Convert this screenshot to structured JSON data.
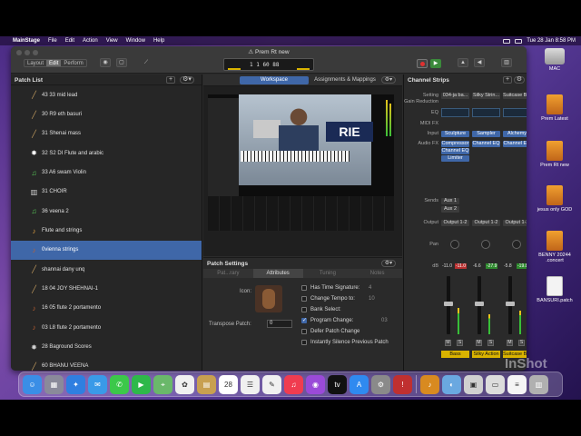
{
  "menubar": {
    "apple": "",
    "app_name": "MainStage",
    "items": [
      "File",
      "Edit",
      "Action",
      "View",
      "Window",
      "Help"
    ],
    "datetime": "Tue 28 Jan  8:58 PM"
  },
  "desktop_icons": [
    {
      "label": "MAC",
      "kind": "drive"
    },
    {
      "label": "Prem Latest",
      "kind": "doc"
    },
    {
      "label": "Prem Rt new",
      "kind": "doc"
    },
    {
      "label": "jesus only GOD",
      "kind": "doc"
    },
    {
      "label": "BENNY 20244 .concert",
      "kind": "doc"
    },
    {
      "label": "BANSURI.patch",
      "kind": "doc2"
    }
  ],
  "window": {
    "title": "⚠ Prem Rt new",
    "mode_tabs": [
      "Layout",
      "Edit",
      "Perform"
    ],
    "active_mode": "Edit",
    "lcd_counter": "1 1  60  88"
  },
  "patch_list": {
    "title": "Patch List",
    "add": "+",
    "gear": "⚙▾",
    "patches": [
      {
        "label": "43 33 mid lead",
        "icon": "flute-icon",
        "glyph": "╱",
        "color": "#c8a060"
      },
      {
        "label": "30 R9 eth basuri",
        "icon": "flute-icon",
        "glyph": "╱",
        "color": "#c8a060"
      },
      {
        "label": "31 Shenai mass",
        "icon": "flute-icon",
        "glyph": "╱",
        "color": "#c8a060"
      },
      {
        "label": "32 S2 DI Flute and arabic",
        "icon": "starburst-icon",
        "glyph": "✸",
        "color": "#ffffff"
      },
      {
        "label": "33 A6 swam Violin",
        "icon": "music-note-icon",
        "glyph": "♫",
        "color": "#5ad05a"
      },
      {
        "label": "31 CHOIR",
        "icon": "organ-icon",
        "glyph": "▥",
        "color": "#cfcfcf"
      },
      {
        "label": "36 veena 2",
        "icon": "music-note-icon",
        "glyph": "♫",
        "color": "#5ad05a"
      },
      {
        "label": "Flute and strings",
        "icon": "guitar-icon",
        "glyph": "♪",
        "color": "#e0a040"
      },
      {
        "label": "0vienna strings",
        "icon": "violin-icon",
        "glyph": "♪",
        "color": "#c06030"
      },
      {
        "label": "shannai dany unq",
        "icon": "flute-icon",
        "glyph": "╱",
        "color": "#c8a060"
      },
      {
        "label": "18 04 JOY SHEHNAI-1",
        "icon": "flute-icon",
        "glyph": "╱",
        "color": "#c8a060"
      },
      {
        "label": "16 05 flute 2 portamento",
        "icon": "violin-icon",
        "glyph": "♪",
        "color": "#c06030"
      },
      {
        "label": "03 L8 flute 2 portamento",
        "icon": "violin-icon",
        "glyph": "♪",
        "color": "#c06030"
      },
      {
        "label": "28 Baground Scores",
        "icon": "starburst-icon",
        "glyph": "✸",
        "color": "#cfcfcf"
      },
      {
        "label": "60 BHANU VEENA",
        "icon": "flute-icon",
        "glyph": "╱",
        "color": "#c8a060"
      }
    ],
    "selected_index": 8
  },
  "workspace": {
    "tabs": [
      "Workspace",
      "Assignments & Mappings"
    ],
    "active_tab": "Workspace",
    "banner_text": "RIE"
  },
  "patch_settings": {
    "title": "Patch Settings",
    "tabs": [
      "Pat...rary",
      "Attributes",
      "Tuning",
      "Notes"
    ],
    "active_tab": "Attributes",
    "icon_label": "Icon:",
    "transpose_label": "Transpose Patch:",
    "transpose_value": "0",
    "options": [
      {
        "label": "Has Time Signature:",
        "checked": false,
        "value": "4"
      },
      {
        "label": "Change Tempo to:",
        "checked": false,
        "value": "10"
      },
      {
        "label": "Bank Select:",
        "checked": false,
        "value": ""
      },
      {
        "label": "Program Change:",
        "checked": true,
        "value": "03"
      },
      {
        "label": "Defer Patch Change",
        "checked": false,
        "value": ""
      },
      {
        "label": "Instantly Silence Previous Patch",
        "checked": false,
        "value": ""
      }
    ]
  },
  "channel_strips": {
    "title": "Channel Strips",
    "row_labels": [
      "Setting",
      "Gain Reduction",
      "EQ",
      "MIDI FX",
      "Input",
      "Audio FX",
      "Sends",
      "Output",
      "Pan",
      "dB"
    ],
    "strips": [
      {
        "setting": "034-ja ba...",
        "input": "Sculpture",
        "fx": [
          "Compressor",
          "Channel EQ",
          "Limiter"
        ],
        "sends": [
          "Aux 1",
          "Aux 2"
        ],
        "output": "Output 1-2",
        "db_left": "-11.0",
        "db_right": "-11.0",
        "name": "Bass",
        "level": 0.45
      },
      {
        "setting": "Silky Strin...",
        "input": "Sampler",
        "fx": [
          "Channel EQ"
        ],
        "sends": [],
        "output": "Output 1-2",
        "db_left": "-6.6",
        "db_right": "-27.9",
        "name": "Silky Action",
        "level": 0.35
      },
      {
        "setting": "Suitcase B...",
        "input": "Alchemy",
        "fx": [
          "Channel EQ"
        ],
        "sends": [],
        "output": "Output 1-2",
        "db_left": "-5.8",
        "db_right": "-19.8",
        "name": "Suitcase Bass",
        "level": 0.4
      }
    ],
    "mute": "M",
    "solo": "S"
  },
  "dock": {
    "apps": [
      {
        "name": "finder-icon",
        "color": "#3a8ee6",
        "glyph": "☺"
      },
      {
        "name": "launchpad-icon",
        "color": "#8a8a9a",
        "glyph": "▦"
      },
      {
        "name": "safari-icon",
        "color": "#2f7fe0",
        "glyph": "✦"
      },
      {
        "name": "mail-icon",
        "color": "#3a9ae8",
        "glyph": "✉"
      },
      {
        "name": "messages-icon",
        "color": "#3cc84a",
        "glyph": "✆"
      },
      {
        "name": "facetime-icon",
        "color": "#2eb84a",
        "glyph": "▶"
      },
      {
        "name": "maps-icon",
        "color": "#6ab86a",
        "glyph": "⌖"
      },
      {
        "name": "photos-icon",
        "color": "#f0f0f0",
        "glyph": "✿"
      },
      {
        "name": "notes-app-icon",
        "color": "#c8a050",
        "glyph": "▤"
      },
      {
        "name": "calendar-icon",
        "color": "#ffffff",
        "glyph": "28"
      },
      {
        "name": "reminders-icon",
        "color": "#f0f0f0",
        "glyph": "☰"
      },
      {
        "name": "notes-icon",
        "color": "#f0f0f0",
        "glyph": "✎"
      },
      {
        "name": "music-icon",
        "color": "#f03c50",
        "glyph": "♫"
      },
      {
        "name": "podcasts-icon",
        "color": "#9a4ad8",
        "glyph": "◉"
      },
      {
        "name": "tv-icon",
        "color": "#111111",
        "glyph": "tv"
      },
      {
        "name": "app-store-icon",
        "color": "#2f8af0",
        "glyph": "A"
      },
      {
        "name": "settings-icon",
        "color": "#8a8a8a",
        "glyph": "⚙"
      },
      {
        "name": "screenshot-icon",
        "color": "#c03030",
        "glyph": "!"
      },
      {
        "name": "mainstage-icon",
        "color": "#d88a20",
        "glyph": "♪"
      },
      {
        "name": "network-icon",
        "color": "#6aa8e0",
        "glyph": "◐"
      },
      {
        "name": "preview-icon",
        "color": "#d0d0d0",
        "glyph": "▣"
      },
      {
        "name": "printer-icon",
        "color": "#dcdcdc",
        "glyph": "▭"
      },
      {
        "name": "document-icon",
        "color": "#f5f5f5",
        "glyph": "≡"
      },
      {
        "name": "trash-icon",
        "color": "#b0b0b0",
        "glyph": "▥"
      }
    ]
  },
  "watermark": "InShot"
}
